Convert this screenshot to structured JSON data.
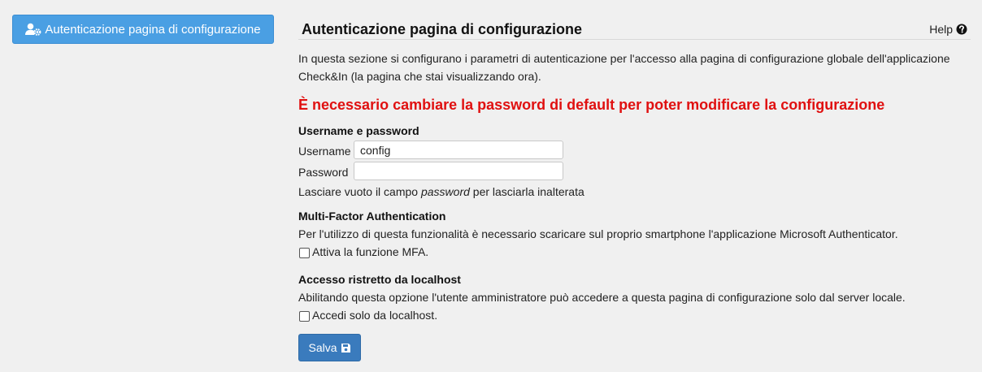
{
  "sidebar": {
    "button_label": "Autenticazione pagina di configurazione",
    "icon": "user-gear-icon"
  },
  "header": {
    "title": "Autenticazione pagina di configurazione",
    "help_label": "Help",
    "help_icon": "question-circle-icon"
  },
  "main": {
    "intro": "In questa sezione si configurano i parametri di autenticazione per l'accesso alla pagina di configurazione globale dell'applicazione Check&In (la pagina che stai visualizzando ora).",
    "warning": "È necessario cambiare la password di default per poter modificare la configurazione",
    "warning_color": "#e01010"
  },
  "credentials": {
    "title": "Username e password",
    "username_label": "Username",
    "username_value": "config",
    "password_label": "Password",
    "password_value": "",
    "hint_before": "Lasciare vuoto il campo ",
    "hint_em": "password",
    "hint_after": " per lasciarla inalterata"
  },
  "mfa": {
    "title": "Multi-Factor Authentication",
    "description": "Per l'utilizzo di questa funzionalità è necessario scaricare sul proprio smartphone l'applicazione Microsoft Authenticator.",
    "checkbox_label": "Attiva la funzione MFA.",
    "checked": false
  },
  "localhost": {
    "title": "Accesso ristretto da localhost",
    "description": "Abilitando questa opzione l'utente amministratore può accedere a questa pagina di configurazione solo dal server locale.",
    "checkbox_label": "Accedi solo da localhost.",
    "checked": false
  },
  "actions": {
    "save_label": "Salva",
    "save_icon": "floppy-disk-icon",
    "accent_color": "#3a7bbd"
  }
}
